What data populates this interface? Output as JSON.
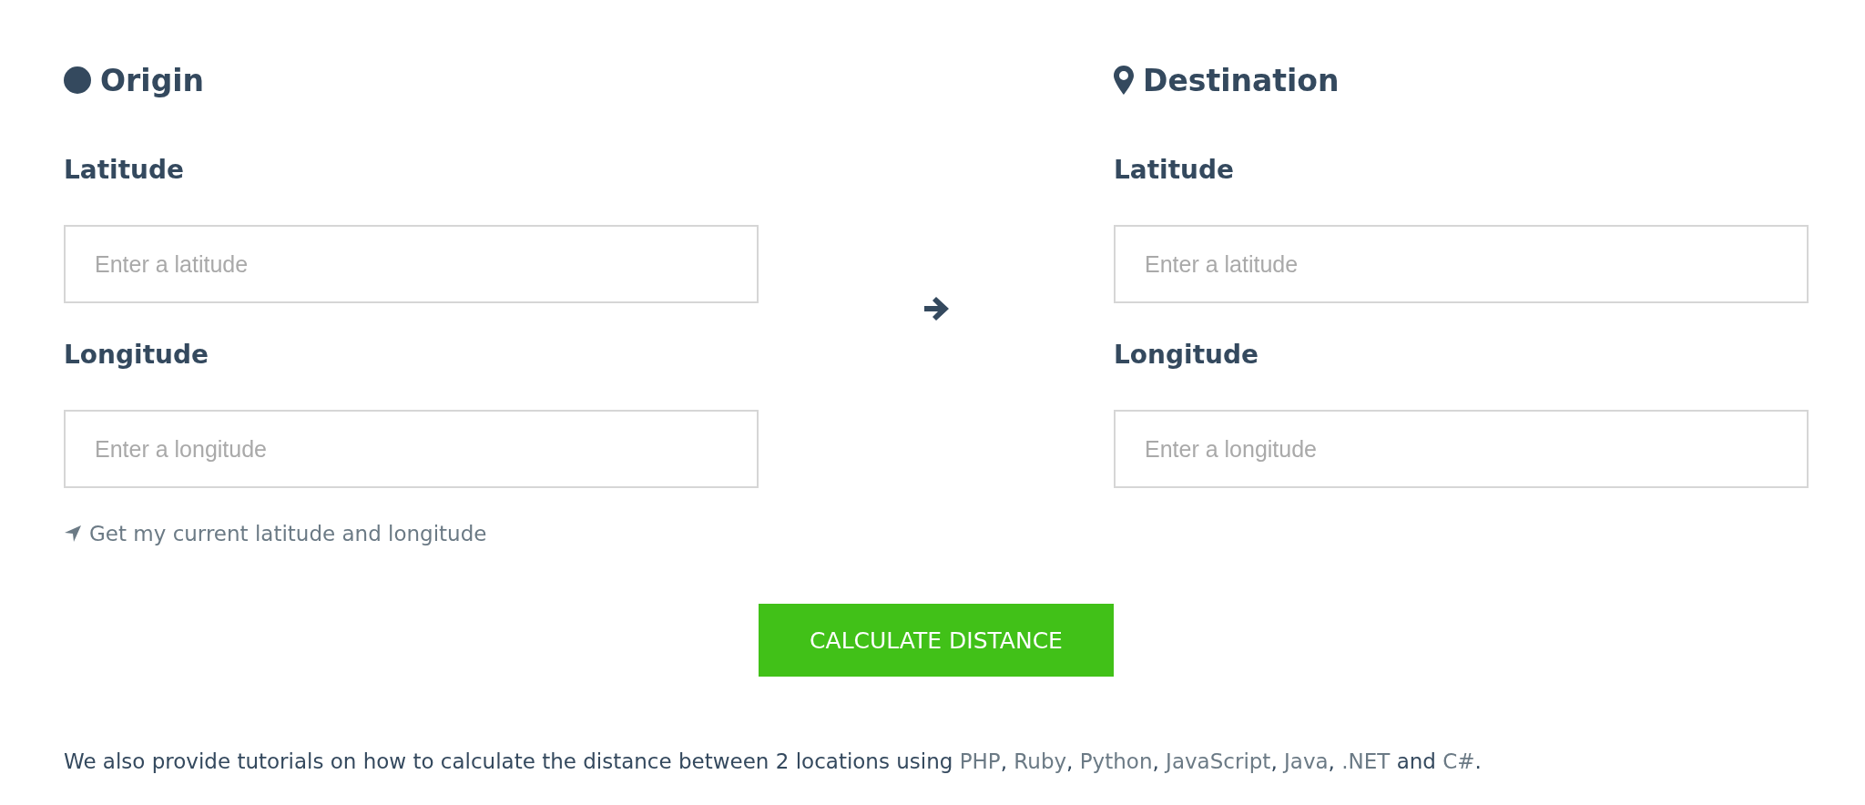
{
  "origin": {
    "title": "Origin",
    "fields": [
      {
        "label": "Latitude",
        "placeholder": "Enter a latitude"
      },
      {
        "label": "Longitude",
        "placeholder": "Enter a longitude"
      }
    ],
    "locate_link": "Get my current latitude and longitude"
  },
  "destination": {
    "title": "Destination",
    "fields": [
      {
        "label": "Latitude",
        "placeholder": "Enter a latitude"
      },
      {
        "label": "Longitude",
        "placeholder": "Enter a longitude"
      }
    ]
  },
  "button": "CALCULATE DISTANCE",
  "footer": [
    {
      "kind": "text",
      "text": "We also provide tutorials on how to calculate the distance between 2 locations using "
    },
    {
      "kind": "link",
      "text": "PHP"
    },
    {
      "kind": "text",
      "text": ", "
    },
    {
      "kind": "link",
      "text": "Ruby"
    },
    {
      "kind": "text",
      "text": ", "
    },
    {
      "kind": "link",
      "text": "Python"
    },
    {
      "kind": "text",
      "text": ", "
    },
    {
      "kind": "link",
      "text": "JavaScript"
    },
    {
      "kind": "text",
      "text": ", "
    },
    {
      "kind": "link",
      "text": "Java"
    },
    {
      "kind": "text",
      "text": ", "
    },
    {
      "kind": "link",
      "text": ".NET"
    },
    {
      "kind": "text",
      "text": " and "
    },
    {
      "kind": "link",
      "text": "C#"
    },
    {
      "kind": "text",
      "text": "."
    }
  ]
}
